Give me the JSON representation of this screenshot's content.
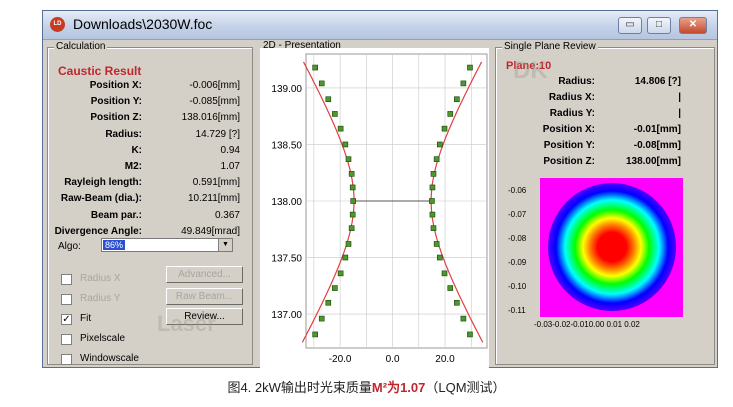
{
  "window": {
    "title": "Downloads\\2030W.foc",
    "icon_text": "LD"
  },
  "window_buttons": {
    "minimize": "▭",
    "maximize": "□",
    "close": "✕"
  },
  "calc": {
    "group_label": "Calculation",
    "heading": "Caustic Result",
    "rows": [
      {
        "label": "Position X:",
        "value": "-0.006[mm]"
      },
      {
        "label": "Position Y:",
        "value": "-0.085[mm]"
      },
      {
        "label": "Position Z:",
        "value": "138.016[mm]"
      },
      {
        "label": "Radius:",
        "value": "14.729 [?]"
      },
      {
        "label": "K:",
        "value": "0.94"
      },
      {
        "label": "M2:",
        "value": "1.07"
      },
      {
        "label": "Rayleigh length:",
        "value": "0.591[mm]"
      },
      {
        "label": "Raw-Beam (dia.):",
        "value": "10.211[mm]"
      },
      {
        "label": "Beam par.:",
        "value": "0.367"
      },
      {
        "label": "Divergence Angle:",
        "value": "49.849[mrad]"
      }
    ],
    "algo_label": "Algo:",
    "algo_value": "86%",
    "checkboxes": [
      {
        "label": "Radius X",
        "checked": false,
        "disabled": true
      },
      {
        "label": "Radius Y",
        "checked": false,
        "disabled": true
      },
      {
        "label": "Fit",
        "checked": true,
        "disabled": false
      },
      {
        "label": "Pixelscale",
        "checked": false,
        "disabled": false
      },
      {
        "label": "Windowscale",
        "checked": false,
        "disabled": false
      }
    ],
    "check_mark": "✓",
    "buttons": {
      "advanced": "Advanced...",
      "raw_beam": "Raw Beam...",
      "review": "Review..."
    }
  },
  "presentation": {
    "group_label": "2D - Presentation",
    "y_ticks": [
      "139.00",
      "138.50",
      "138.00",
      "137.50",
      "137.00"
    ],
    "x_ticks": [
      "-20.0",
      "0.0",
      "20.0"
    ]
  },
  "chart_data": {
    "type": "scatter",
    "title": "",
    "xlabel": "",
    "ylabel": "",
    "xlim": [
      -33,
      36
    ],
    "ylim": [
      136.7,
      139.3
    ],
    "waist_z": 138.0,
    "waist_radius": 14.7,
    "series": [
      {
        "color": "#4a9a2a",
        "points_right": [
          [
            29.5,
            139.18
          ],
          [
            27.0,
            139.04
          ],
          [
            24.5,
            138.9
          ],
          [
            22.0,
            138.77
          ],
          [
            19.8,
            138.64
          ],
          [
            18.0,
            138.5
          ],
          [
            16.8,
            138.37
          ],
          [
            15.6,
            138.24
          ],
          [
            15.2,
            138.12
          ],
          [
            15.0,
            138.0
          ],
          [
            15.2,
            137.88
          ],
          [
            15.6,
            137.76
          ],
          [
            16.8,
            137.62
          ],
          [
            18.0,
            137.5
          ],
          [
            19.8,
            137.36
          ],
          [
            22.0,
            137.23
          ],
          [
            24.5,
            137.1
          ],
          [
            27.0,
            136.96
          ],
          [
            29.5,
            136.82
          ]
        ],
        "points_left": [
          [
            -29.5,
            139.18
          ],
          [
            -27.0,
            139.04
          ],
          [
            -24.5,
            138.9
          ],
          [
            -22.0,
            138.77
          ],
          [
            -19.8,
            138.64
          ],
          [
            -18.0,
            138.5
          ],
          [
            -16.8,
            138.37
          ],
          [
            -15.6,
            138.24
          ],
          [
            -15.2,
            138.12
          ],
          [
            -15.0,
            138.0
          ],
          [
            -15.2,
            137.88
          ],
          [
            -15.6,
            137.76
          ],
          [
            -16.8,
            137.62
          ],
          [
            -18.0,
            137.5
          ],
          [
            -19.8,
            137.36
          ],
          [
            -22.0,
            137.23
          ],
          [
            -24.5,
            137.1
          ],
          [
            -27.0,
            136.96
          ],
          [
            -29.5,
            136.82
          ]
        ]
      }
    ],
    "fit_color": "#e04040"
  },
  "review": {
    "group_label": "Single Plane Review",
    "plane": "Plane:10",
    "rows": [
      {
        "label": "Radius:",
        "value": "14.806 [?]"
      },
      {
        "label": "Radius X:",
        "value": "|"
      },
      {
        "label": "Radius Y:",
        "value": "|"
      },
      {
        "label": "Position X:",
        "value": "-0.01[mm]"
      },
      {
        "label": "Position Y:",
        "value": "-0.08[mm]"
      },
      {
        "label": "Position Z:",
        "value": "138.00[mm]"
      }
    ],
    "heat_y_ticks": [
      "-0.06",
      "-0.07",
      "-0.08",
      "-0.09",
      "-0.10",
      "-0.11"
    ],
    "heat_x_ticks": "-0.03-0.02-0.010.00 0.01 0.02"
  },
  "watermark": {
    "brand": "DK Laser",
    "cn": "大 科 激 光"
  },
  "caption": {
    "prefix": "图4. 2kW输出时光束质量",
    "emph": "M²为1.07",
    "suffix": "（LQM测试）"
  }
}
